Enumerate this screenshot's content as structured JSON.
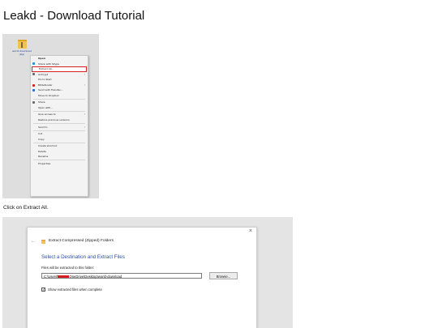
{
  "page": {
    "title": "Leakd - Download Tutorial",
    "caption_1": "Click on Extract All."
  },
  "desktop": {
    "folder_label": "world-download (zip)"
  },
  "context_menu": {
    "items": [
      {
        "label": "Open",
        "bold": true,
        "icon": "",
        "arrow": false,
        "sep_after": false,
        "highlight": false
      },
      {
        "label": "Share with Skype",
        "bold": false,
        "icon": "skype-icon",
        "icon_color": "#1e90d6",
        "arrow": false,
        "sep_after": false,
        "highlight": false
      },
      {
        "label": "Extract All...",
        "bold": false,
        "icon": "",
        "arrow": false,
        "sep_after": false,
        "highlight": true
      },
      {
        "label": "AxCrypt",
        "bold": false,
        "icon": "axcrypt-icon",
        "icon_color": "#6a6a6a",
        "arrow": true,
        "sep_after": false,
        "highlight": false
      },
      {
        "label": "Pin to Start",
        "bold": false,
        "icon": "",
        "arrow": false,
        "sep_after": false,
        "highlight": false
      },
      {
        "label": "Bitdefender",
        "bold": false,
        "icon": "bitdefender-icon",
        "icon_color": "#d42020",
        "arrow": true,
        "sep_after": false,
        "highlight": false
      },
      {
        "label": "Send with Transfer...",
        "bold": false,
        "icon": "transfer-icon",
        "icon_color": "#2b6cd8",
        "arrow": false,
        "sep_after": false,
        "highlight": false
      },
      {
        "label": "Move to Dropbox",
        "bold": false,
        "icon": "",
        "arrow": false,
        "sep_after": true,
        "highlight": false
      },
      {
        "label": "Share",
        "bold": false,
        "icon": "share-icon",
        "icon_color": "#6a6a6a",
        "arrow": false,
        "sep_after": false,
        "highlight": false
      },
      {
        "label": "Open with...",
        "bold": false,
        "icon": "",
        "arrow": false,
        "sep_after": true,
        "highlight": false
      },
      {
        "label": "Give access to",
        "bold": false,
        "icon": "",
        "arrow": true,
        "sep_after": false,
        "highlight": false
      },
      {
        "label": "Restore previous versions",
        "bold": false,
        "icon": "",
        "arrow": false,
        "sep_after": true,
        "highlight": false
      },
      {
        "label": "Send to",
        "bold": false,
        "icon": "",
        "arrow": true,
        "sep_after": true,
        "highlight": false
      },
      {
        "label": "Cut",
        "bold": false,
        "icon": "",
        "arrow": false,
        "sep_after": false,
        "highlight": false
      },
      {
        "label": "Copy",
        "bold": false,
        "icon": "",
        "arrow": false,
        "sep_after": true,
        "highlight": false
      },
      {
        "label": "Create shortcut",
        "bold": false,
        "icon": "",
        "arrow": false,
        "sep_after": false,
        "highlight": false
      },
      {
        "label": "Delete",
        "bold": false,
        "icon": "",
        "arrow": false,
        "sep_after": false,
        "highlight": false
      },
      {
        "label": "Rename",
        "bold": false,
        "icon": "",
        "arrow": false,
        "sep_after": true,
        "highlight": false
      },
      {
        "label": "Properties",
        "bold": false,
        "icon": "",
        "arrow": false,
        "sep_after": false,
        "highlight": false
      }
    ]
  },
  "extract_dialog": {
    "close_glyph": "×",
    "back_glyph": "←",
    "title": "Extract Compressed (Zipped) Folders",
    "heading": "Select a Destination and Extract Files",
    "label": "Files will be extracted to this folder:",
    "path_prefix": "C:\\Users\\",
    "path_suffix": "OneDrive\\Desktop\\world-download",
    "browse_label": "Browse...",
    "show_files_checked": true,
    "check_glyph": "✓",
    "show_files_label": "Show extracted files when complete"
  },
  "colors": {
    "highlight_border": "#d42020",
    "heading_blue": "#2b4fa8"
  }
}
